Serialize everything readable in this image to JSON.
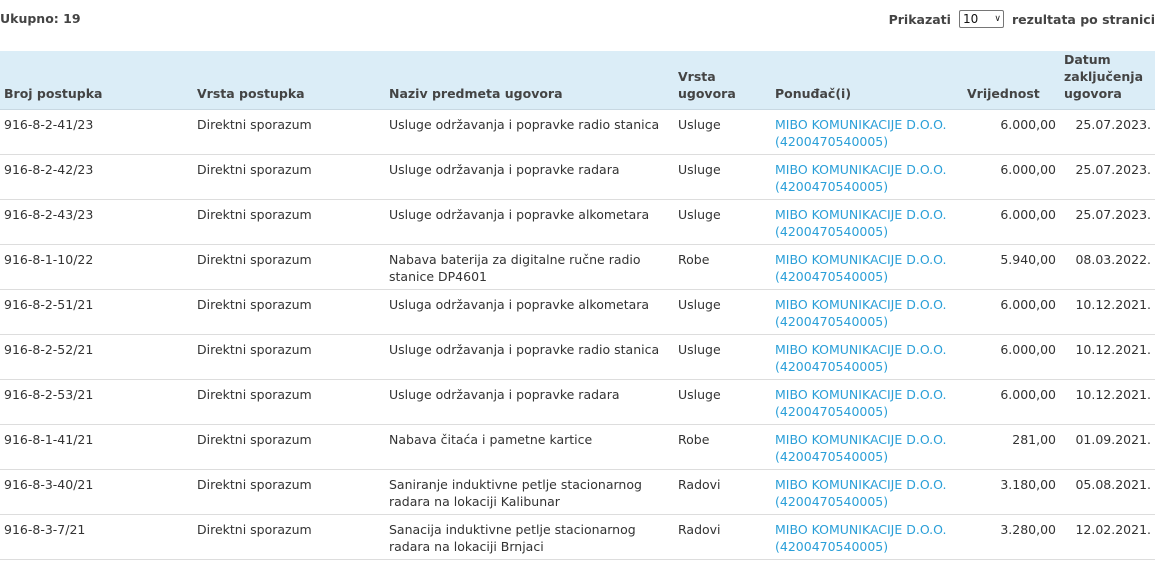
{
  "summary": {
    "total": "Ukupno: 19"
  },
  "pager": {
    "before": "Prikazati",
    "selected": "10",
    "after": "rezultata po stranici"
  },
  "table": {
    "headers": {
      "broj": "Broj postupka",
      "vrsta_postupka": "Vrsta postupka",
      "naziv": "Naziv predmeta ugovora",
      "vrsta_ugovora": "Vrsta ugovora",
      "ponudac": "Ponuđač(i)",
      "vrijednost": "Vrijednost",
      "datum": "Datum zaključenja ugovora"
    },
    "rows": [
      {
        "broj": "916-8-2-41/23",
        "vrsta_postupka": "Direktni sporazum",
        "naziv": "Usluge održavanja i popravke radio stanica",
        "vrsta_ugovora": "Usluge",
        "ponudac": "MIBO KOMUNIKACIJE D.O.O. (4200470540005)",
        "vrijednost": "6.000,00",
        "datum": "25.07.2023."
      },
      {
        "broj": "916-8-2-42/23",
        "vrsta_postupka": "Direktni sporazum",
        "naziv": "Usluge održavanja i popravke radara",
        "vrsta_ugovora": "Usluge",
        "ponudac": "MIBO KOMUNIKACIJE D.O.O. (4200470540005)",
        "vrijednost": "6.000,00",
        "datum": "25.07.2023."
      },
      {
        "broj": "916-8-2-43/23",
        "vrsta_postupka": "Direktni sporazum",
        "naziv": "Usluge održavanja i popravke alkometara",
        "vrsta_ugovora": "Usluge",
        "ponudac": "MIBO KOMUNIKACIJE D.O.O. (4200470540005)",
        "vrijednost": "6.000,00",
        "datum": "25.07.2023."
      },
      {
        "broj": "916-8-1-10/22",
        "vrsta_postupka": "Direktni sporazum",
        "naziv": "Nabava baterija za digitalne ručne radio stanice DP4601",
        "vrsta_ugovora": "Robe",
        "ponudac": "MIBO KOMUNIKACIJE D.O.O. (4200470540005)",
        "vrijednost": "5.940,00",
        "datum": "08.03.2022."
      },
      {
        "broj": "916-8-2-51/21",
        "vrsta_postupka": "Direktni sporazum",
        "naziv": "Usluga održavanja i popravke alkometara",
        "vrsta_ugovora": "Usluge",
        "ponudac": "MIBO KOMUNIKACIJE D.O.O. (4200470540005)",
        "vrijednost": "6.000,00",
        "datum": "10.12.2021."
      },
      {
        "broj": "916-8-2-52/21",
        "vrsta_postupka": "Direktni sporazum",
        "naziv": "Usluge održavanja i popravke radio stanica",
        "vrsta_ugovora": "Usluge",
        "ponudac": "MIBO KOMUNIKACIJE D.O.O. (4200470540005)",
        "vrijednost": "6.000,00",
        "datum": "10.12.2021."
      },
      {
        "broj": "916-8-2-53/21",
        "vrsta_postupka": "Direktni sporazum",
        "naziv": "Usluge održavanja i popravke radara",
        "vrsta_ugovora": "Usluge",
        "ponudac": "MIBO KOMUNIKACIJE D.O.O. (4200470540005)",
        "vrijednost": "6.000,00",
        "datum": "10.12.2021."
      },
      {
        "broj": "916-8-1-41/21",
        "vrsta_postupka": "Direktni sporazum",
        "naziv": "Nabava čitaća i pametne kartice",
        "vrsta_ugovora": "Robe",
        "ponudac": "MIBO KOMUNIKACIJE D.O.O. (4200470540005)",
        "vrijednost": "281,00",
        "datum": "01.09.2021."
      },
      {
        "broj": "916-8-3-40/21",
        "vrsta_postupka": "Direktni sporazum",
        "naziv": "Saniranje induktivne petlje stacionarnog radara na lokaciji Kalibunar",
        "vrsta_ugovora": "Radovi",
        "ponudac": "MIBO KOMUNIKACIJE D.O.O. (4200470540005)",
        "vrijednost": "3.180,00",
        "datum": "05.08.2021."
      },
      {
        "broj": "916-8-3-7/21",
        "vrsta_postupka": "Direktni sporazum",
        "naziv": "Sanacija induktivne petlje stacionarnog radara na lokaciji Brnjaci",
        "vrsta_ugovora": "Radovi",
        "ponudac": "MIBO KOMUNIKACIJE D.O.O. (4200470540005)",
        "vrijednost": "3.280,00",
        "datum": "12.02.2021."
      }
    ]
  },
  "colors": {
    "header_bg": "#dbedf7",
    "link": "#2a9fd8"
  },
  "icons": {
    "select_arrow": "chevron-down-icon"
  }
}
